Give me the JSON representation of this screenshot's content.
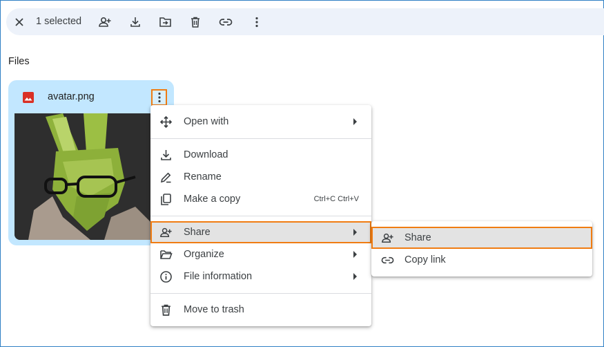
{
  "toolbar": {
    "selected_count": "1 selected",
    "icons": [
      "close-icon",
      "add-person-icon",
      "download-icon",
      "move-to-folder-icon",
      "trash-icon",
      "link-icon",
      "more-vert-icon"
    ]
  },
  "files_section": {
    "title": "Files"
  },
  "file_card": {
    "name": "avatar.png",
    "type_icon": "image-file-icon",
    "type_icon_color": "#d93025"
  },
  "context_menu": {
    "items": [
      {
        "label": "Open with",
        "icon": "move-arrows-icon",
        "submenu": true
      },
      {
        "label": "Download",
        "icon": "download-icon"
      },
      {
        "label": "Rename",
        "icon": "pencil-icon"
      },
      {
        "label": "Make a copy",
        "icon": "copy-icon",
        "shortcut": "Ctrl+C Ctrl+V"
      },
      {
        "label": "Share",
        "icon": "add-person-icon",
        "submenu": true,
        "highlighted": true
      },
      {
        "label": "Organize",
        "icon": "folder-open-icon",
        "submenu": true
      },
      {
        "label": "File information",
        "icon": "info-icon",
        "submenu": true
      },
      {
        "label": "Move to trash",
        "icon": "trash-icon"
      }
    ]
  },
  "share_submenu": {
    "items": [
      {
        "label": "Share",
        "icon": "add-person-icon",
        "highlighted": true
      },
      {
        "label": "Copy link",
        "icon": "link-icon"
      }
    ]
  },
  "colors": {
    "highlight_outline": "#f07c12",
    "card_background": "#c2e7ff",
    "toolbar_background": "#edf2fa",
    "menu_highlight": "#e3e3e3"
  }
}
